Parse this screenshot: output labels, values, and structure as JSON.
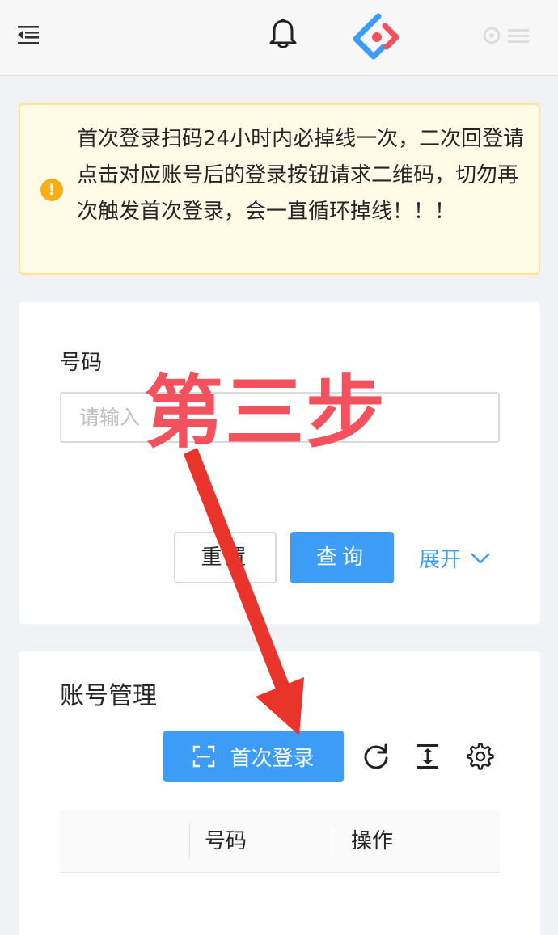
{
  "alert": {
    "icon": "exclamation-circle-icon",
    "text": "首次登录扫码24小时内必掉线一次，二次回登请点击对应账号后的登录按钮请求二维码，切勿再次触发首次登录，会一直循环掉线！！！"
  },
  "search": {
    "field_label": "号码",
    "placeholder": "请输入",
    "reset_label": "重置",
    "query_label": "查询",
    "expand_label": "展开"
  },
  "table": {
    "title": "账号管理",
    "first_login_label": "首次登录",
    "columns": [
      "号码",
      "操作"
    ]
  },
  "annotation": {
    "step_text": "第三步"
  },
  "colors": {
    "primary": "#3d9df6",
    "warning": "#faad14",
    "annotation": "#e8342a"
  }
}
